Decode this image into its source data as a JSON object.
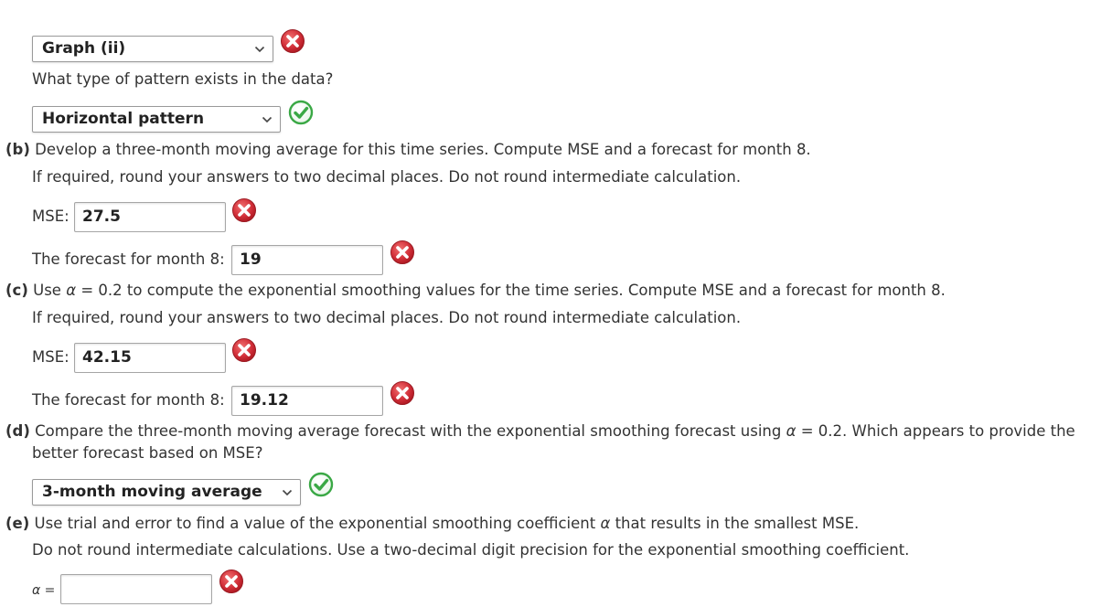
{
  "part_a": {
    "graph_select": "Graph (ii)",
    "pattern_question": "What type of pattern exists in the data?",
    "pattern_select": "Horizontal pattern"
  },
  "part_b": {
    "letter": "(b)",
    "line1": "Develop a three-month moving average for this time series. Compute MSE and a forecast for month 8.",
    "line2": "If required, round your answers to two decimal places. Do not round intermediate calculation.",
    "mse_label": "MSE:",
    "mse_value": "27.5",
    "forecast_label": "The forecast for month 8:",
    "forecast_value": "19"
  },
  "part_c": {
    "letter": "(c)",
    "line1_pre": "Use",
    "alpha": "α",
    "line1_post": "= 0.2 to compute the exponential smoothing values for the time series. Compute MSE and a forecast for month 8.",
    "line2": "If required, round your answers to two decimal places. Do not round intermediate calculation.",
    "mse_label": "MSE:",
    "mse_value": "42.15",
    "forecast_label": "The forecast for month 8:",
    "forecast_value": "19.12"
  },
  "part_d": {
    "letter": "(d)",
    "line1_pre": "Compare the three-month moving average forecast with the exponential smoothing forecast using",
    "alpha": "α",
    "line1_post": "= 0.2. Which appears to provide the",
    "line2": "better forecast based on MSE?",
    "answer_select": "3-month moving average"
  },
  "part_e": {
    "letter": "(e)",
    "line1_pre": "Use trial and error to find a value of the exponential smoothing coefficient",
    "alpha": "α",
    "line1_post": "that results in the smallest MSE.",
    "line2": "Do not round intermediate calculations. Use a two-decimal digit precision for the exponential smoothing coefficient.",
    "alpha_label": "α =",
    "alpha_value": ""
  },
  "icons": {
    "incorrect": "incorrect-x-icon",
    "correct": "correct-check-icon",
    "incorrect_color": "#d32f3a",
    "correct_color": "#3aa845"
  }
}
